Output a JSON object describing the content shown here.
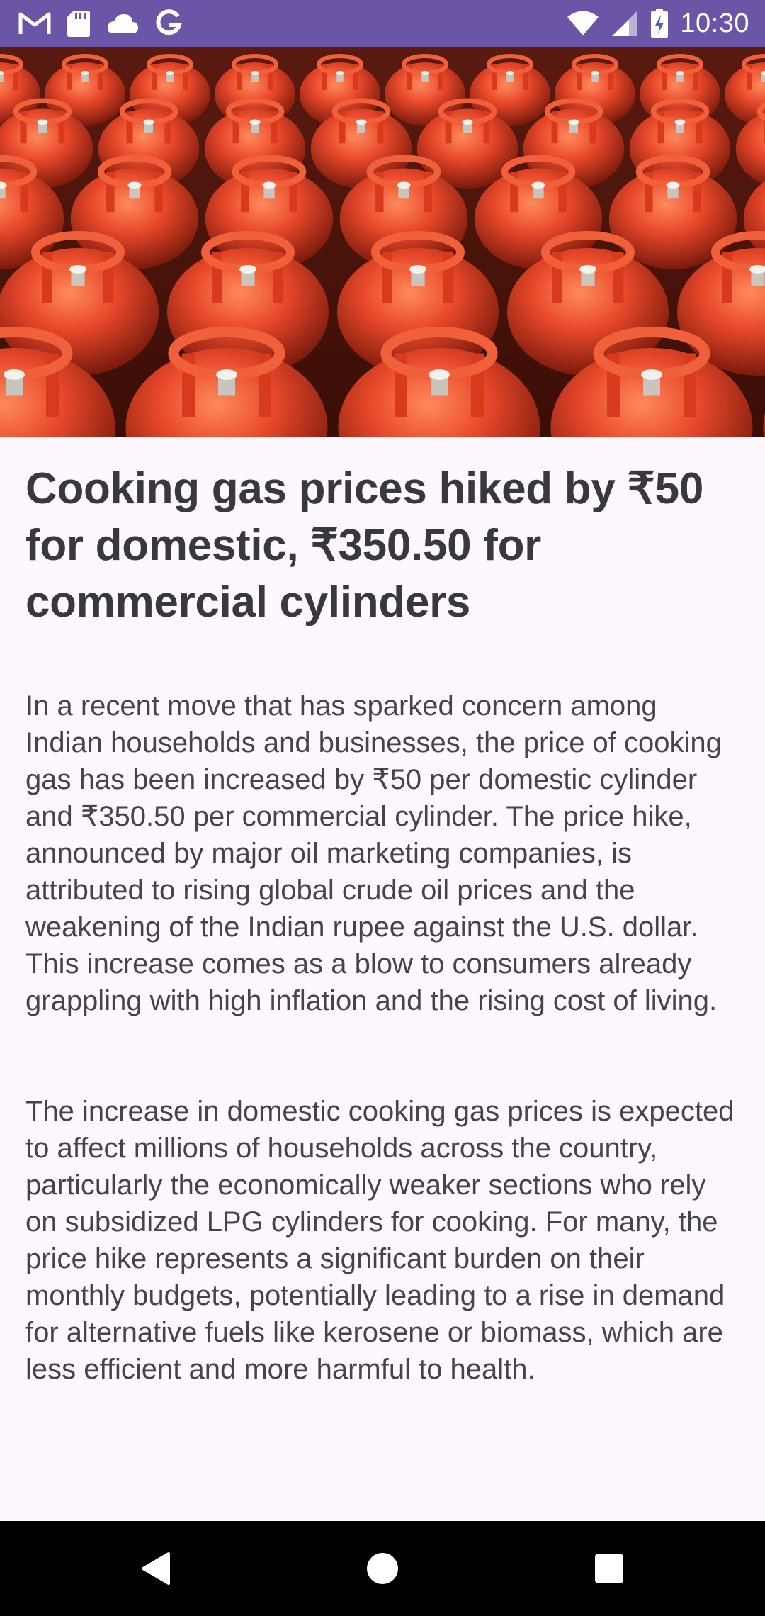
{
  "status_bar": {
    "time": "10:30",
    "left_icons": [
      "gmail-icon",
      "sd-card-icon",
      "cloud-icon",
      "google-icon"
    ],
    "right_icons": [
      "wifi-icon",
      "cell-signal-icon",
      "battery-charging-icon"
    ],
    "background_color": "#6a55a6"
  },
  "hero_image": {
    "subject": "rows of red LPG cylinders"
  },
  "article": {
    "headline": "Cooking gas prices hiked by ₹50 for domestic, ₹350.50 for commercial cylinders",
    "paragraphs": [
      "In a recent move that has sparked concern among Indian households and businesses, the price of cooking gas has been increased by ₹50 per domestic cylinder and ₹350.50 per commercial cylinder. The price hike, announced by major oil marketing companies, is attributed to rising global crude oil prices and the weakening of the Indian rupee against the U.S. dollar. This increase comes as a blow to consumers already grappling with high inflation and the rising cost of living.",
      "The increase in domestic cooking gas prices is expected to affect millions of households across the country, particularly the economically weaker sections who rely on subsidized LPG cylinders for cooking. For many, the price hike represents a significant burden on their monthly budgets, potentially leading to a rise in demand for alternative fuels like kerosene or biomass, which are less efficient and more harmful to health."
    ]
  },
  "nav_bar": {
    "buttons": [
      "back-icon",
      "home-icon",
      "recents-icon"
    ]
  }
}
